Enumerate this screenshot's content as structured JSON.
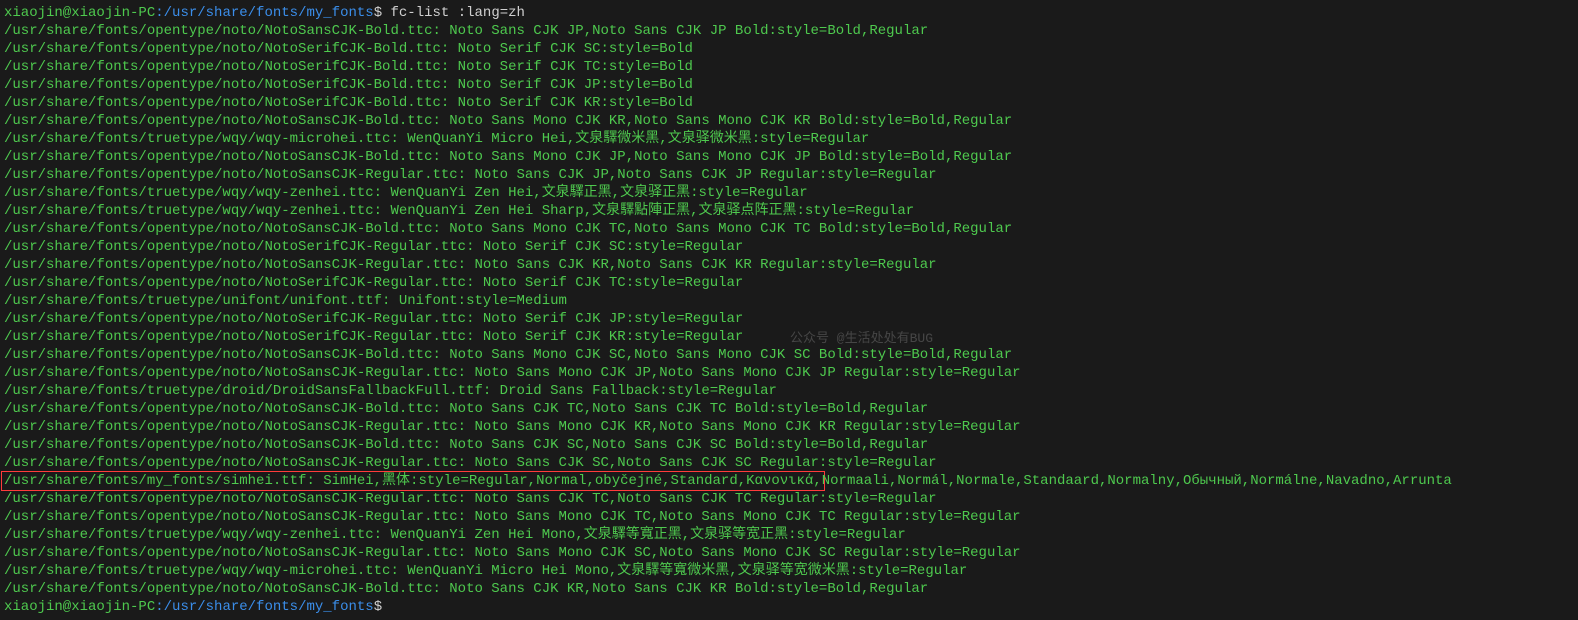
{
  "prompt1": {
    "user": "xiaojin@xiaojin-PC",
    "colon": ":",
    "path": "/usr/share/fonts/my_fonts",
    "dollar": "$",
    "command": "fc-list :lang=zh"
  },
  "lines": [
    "/usr/share/fonts/opentype/noto/NotoSansCJK-Bold.ttc: Noto Sans CJK JP,Noto Sans CJK JP Bold:style=Bold,Regular",
    "/usr/share/fonts/opentype/noto/NotoSerifCJK-Bold.ttc: Noto Serif CJK SC:style=Bold",
    "/usr/share/fonts/opentype/noto/NotoSerifCJK-Bold.ttc: Noto Serif CJK TC:style=Bold",
    "/usr/share/fonts/opentype/noto/NotoSerifCJK-Bold.ttc: Noto Serif CJK JP:style=Bold",
    "/usr/share/fonts/opentype/noto/NotoSerifCJK-Bold.ttc: Noto Serif CJK KR:style=Bold",
    "/usr/share/fonts/opentype/noto/NotoSansCJK-Bold.ttc: Noto Sans Mono CJK KR,Noto Sans Mono CJK KR Bold:style=Bold,Regular",
    "/usr/share/fonts/truetype/wqy/wqy-microhei.ttc: WenQuanYi Micro Hei,文泉驛微米黑,文泉驿微米黑:style=Regular",
    "/usr/share/fonts/opentype/noto/NotoSansCJK-Bold.ttc: Noto Sans Mono CJK JP,Noto Sans Mono CJK JP Bold:style=Bold,Regular",
    "/usr/share/fonts/opentype/noto/NotoSansCJK-Regular.ttc: Noto Sans CJK JP,Noto Sans CJK JP Regular:style=Regular",
    "/usr/share/fonts/truetype/wqy/wqy-zenhei.ttc: WenQuanYi Zen Hei,文泉驛正黑,文泉驿正黑:style=Regular",
    "/usr/share/fonts/truetype/wqy/wqy-zenhei.ttc: WenQuanYi Zen Hei Sharp,文泉驛點陣正黑,文泉驿点阵正黑:style=Regular",
    "/usr/share/fonts/opentype/noto/NotoSansCJK-Bold.ttc: Noto Sans Mono CJK TC,Noto Sans Mono CJK TC Bold:style=Bold,Regular",
    "/usr/share/fonts/opentype/noto/NotoSerifCJK-Regular.ttc: Noto Serif CJK SC:style=Regular",
    "/usr/share/fonts/opentype/noto/NotoSansCJK-Regular.ttc: Noto Sans CJK KR,Noto Sans CJK KR Regular:style=Regular",
    "/usr/share/fonts/opentype/noto/NotoSerifCJK-Regular.ttc: Noto Serif CJK TC:style=Regular",
    "/usr/share/fonts/truetype/unifont/unifont.ttf: Unifont:style=Medium",
    "/usr/share/fonts/opentype/noto/NotoSerifCJK-Regular.ttc: Noto Serif CJK JP:style=Regular",
    "/usr/share/fonts/opentype/noto/NotoSerifCJK-Regular.ttc: Noto Serif CJK KR:style=Regular",
    "/usr/share/fonts/opentype/noto/NotoSansCJK-Bold.ttc: Noto Sans Mono CJK SC,Noto Sans Mono CJK SC Bold:style=Bold,Regular",
    "/usr/share/fonts/opentype/noto/NotoSansCJK-Regular.ttc: Noto Sans Mono CJK JP,Noto Sans Mono CJK JP Regular:style=Regular",
    "/usr/share/fonts/truetype/droid/DroidSansFallbackFull.ttf: Droid Sans Fallback:style=Regular",
    "/usr/share/fonts/opentype/noto/NotoSansCJK-Bold.ttc: Noto Sans CJK TC,Noto Sans CJK TC Bold:style=Bold,Regular",
    "/usr/share/fonts/opentype/noto/NotoSansCJK-Regular.ttc: Noto Sans Mono CJK KR,Noto Sans Mono CJK KR Regular:style=Regular",
    "/usr/share/fonts/opentype/noto/NotoSansCJK-Bold.ttc: Noto Sans CJK SC,Noto Sans CJK SC Bold:style=Bold,Regular",
    "/usr/share/fonts/opentype/noto/NotoSansCJK-Regular.ttc: Noto Sans CJK SC,Noto Sans CJK SC Regular:style=Regular"
  ],
  "highlight_line": {
    "boxed": "/usr/share/fonts/my_fonts/simhei.ttf: SimHei,黑体:style=Regular,Normal,obyčejné,Standard,Κανονικά,",
    "tail": "Normaali,Normál,Normale,Standaard,Normalny,Обычный,Normálne,Navadno,Arrunta"
  },
  "lines_after": [
    "/usr/share/fonts/opentype/noto/NotoSansCJK-Regular.ttc: Noto Sans CJK TC,Noto Sans CJK TC Regular:style=Regular",
    "/usr/share/fonts/opentype/noto/NotoSansCJK-Regular.ttc: Noto Sans Mono CJK TC,Noto Sans Mono CJK TC Regular:style=Regular",
    "/usr/share/fonts/truetype/wqy/wqy-zenhei.ttc: WenQuanYi Zen Hei Mono,文泉驛等寬正黑,文泉驿等宽正黑:style=Regular",
    "/usr/share/fonts/opentype/noto/NotoSansCJK-Regular.ttc: Noto Sans Mono CJK SC,Noto Sans Mono CJK SC Regular:style=Regular",
    "/usr/share/fonts/truetype/wqy/wqy-microhei.ttc: WenQuanYi Micro Hei Mono,文泉驛等寬微米黑,文泉驿等宽微米黑:style=Regular",
    "/usr/share/fonts/opentype/noto/NotoSansCJK-Bold.ttc: Noto Sans CJK KR,Noto Sans CJK KR Bold:style=Bold,Regular"
  ],
  "prompt2": {
    "user": "xiaojin@xiaojin-PC",
    "colon": ":",
    "path": "/usr/share/fonts/my_fonts",
    "dollar": "$"
  },
  "watermark": "公众号 @生活处处有BUG"
}
